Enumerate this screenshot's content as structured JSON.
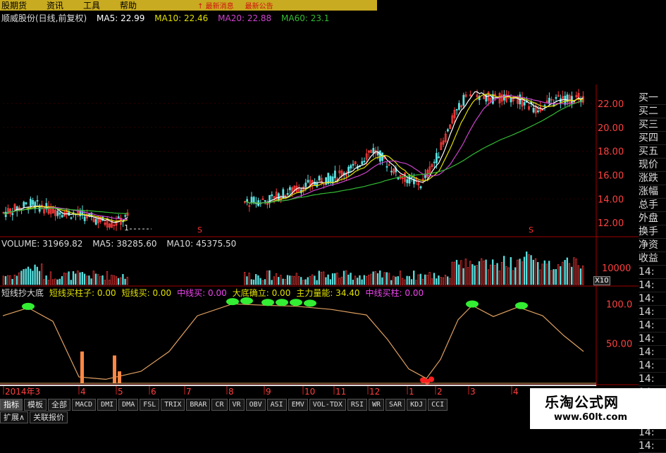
{
  "menu": {
    "items": [
      "股期货",
      "资讯",
      "工具",
      "帮助"
    ],
    "alert_left": "↑ 最新消息",
    "alert_right": "最新公告"
  },
  "title": {
    "stock": "顺威股份(日线,前复权)",
    "ma5": "MA5: 22.99",
    "ma10": "MA10: 22.46",
    "ma20": "MA20: 22.88",
    "ma60": "MA60: 23.1"
  },
  "volume": {
    "label": "VOLUME: 31969.82",
    "ma5": "MA5: 38285.60",
    "ma10": "MA10: 45375.50",
    "x10": "X10"
  },
  "indicator": {
    "items": [
      {
        "text": "短线抄大底",
        "color": "#dddddd"
      },
      {
        "text": "短线买柱子: 0.00",
        "color": "#e0e000"
      },
      {
        "text": "短线买: 0.00",
        "color": "#e0e000"
      },
      {
        "text": "中线买: 0.00",
        "color": "#ee44ee"
      },
      {
        "text": "大底确立: 0.00",
        "color": "#e0e000"
      },
      {
        "text": "主力量能: 34.40",
        "color": "#e0e000"
      },
      {
        "text": "中线买柱: 0.00",
        "color": "#ee44ee"
      }
    ]
  },
  "price_axis": [
    "22.00",
    "20.00",
    "18.00",
    "16.00",
    "14.00",
    "12.00"
  ],
  "vol_axis": [
    "10000"
  ],
  "ind_axis": [
    "100.0",
    "50.00"
  ],
  "right_labels": [
    "买一",
    "买二",
    "买三",
    "买四",
    "买五",
    "现价",
    "涨跌",
    "涨幅",
    "总手",
    "外盘",
    "换手",
    "净资",
    "收益",
    "14:",
    "14:",
    "14:",
    "14:",
    "14:",
    "14:",
    "14:",
    "14:",
    "14:",
    "14:",
    "14:",
    "14:",
    "14:",
    "14:"
  ],
  "months": [
    "2014年3",
    "4",
    "5",
    "6",
    "7",
    "8",
    "9",
    "10",
    "11",
    "12",
    "1",
    "2",
    "3",
    "4"
  ],
  "low_label": "1",
  "tabs": [
    "指标",
    "模板",
    "全部",
    "MACD",
    "DMI",
    "DMA",
    "FSL",
    "TRIX",
    "BRAR",
    "CR",
    "VR",
    "OBV",
    "ASI",
    "EMV",
    "VOL-TDX",
    "RSI",
    "WR",
    "SAR",
    "KDJ",
    "CCI"
  ],
  "tabs_row2": [
    "扩展∧",
    "关联报价"
  ],
  "watermark": {
    "name": "乐淘公式网",
    "url": "www.60lt.com"
  },
  "colors": {
    "up": "#ff3b3b",
    "down": "#5be0e0",
    "ma5": "#ffffff",
    "ma10": "#e0e000",
    "ma20": "#cc44cc",
    "ma60": "#33bb33",
    "grid": "#a00000"
  }
}
